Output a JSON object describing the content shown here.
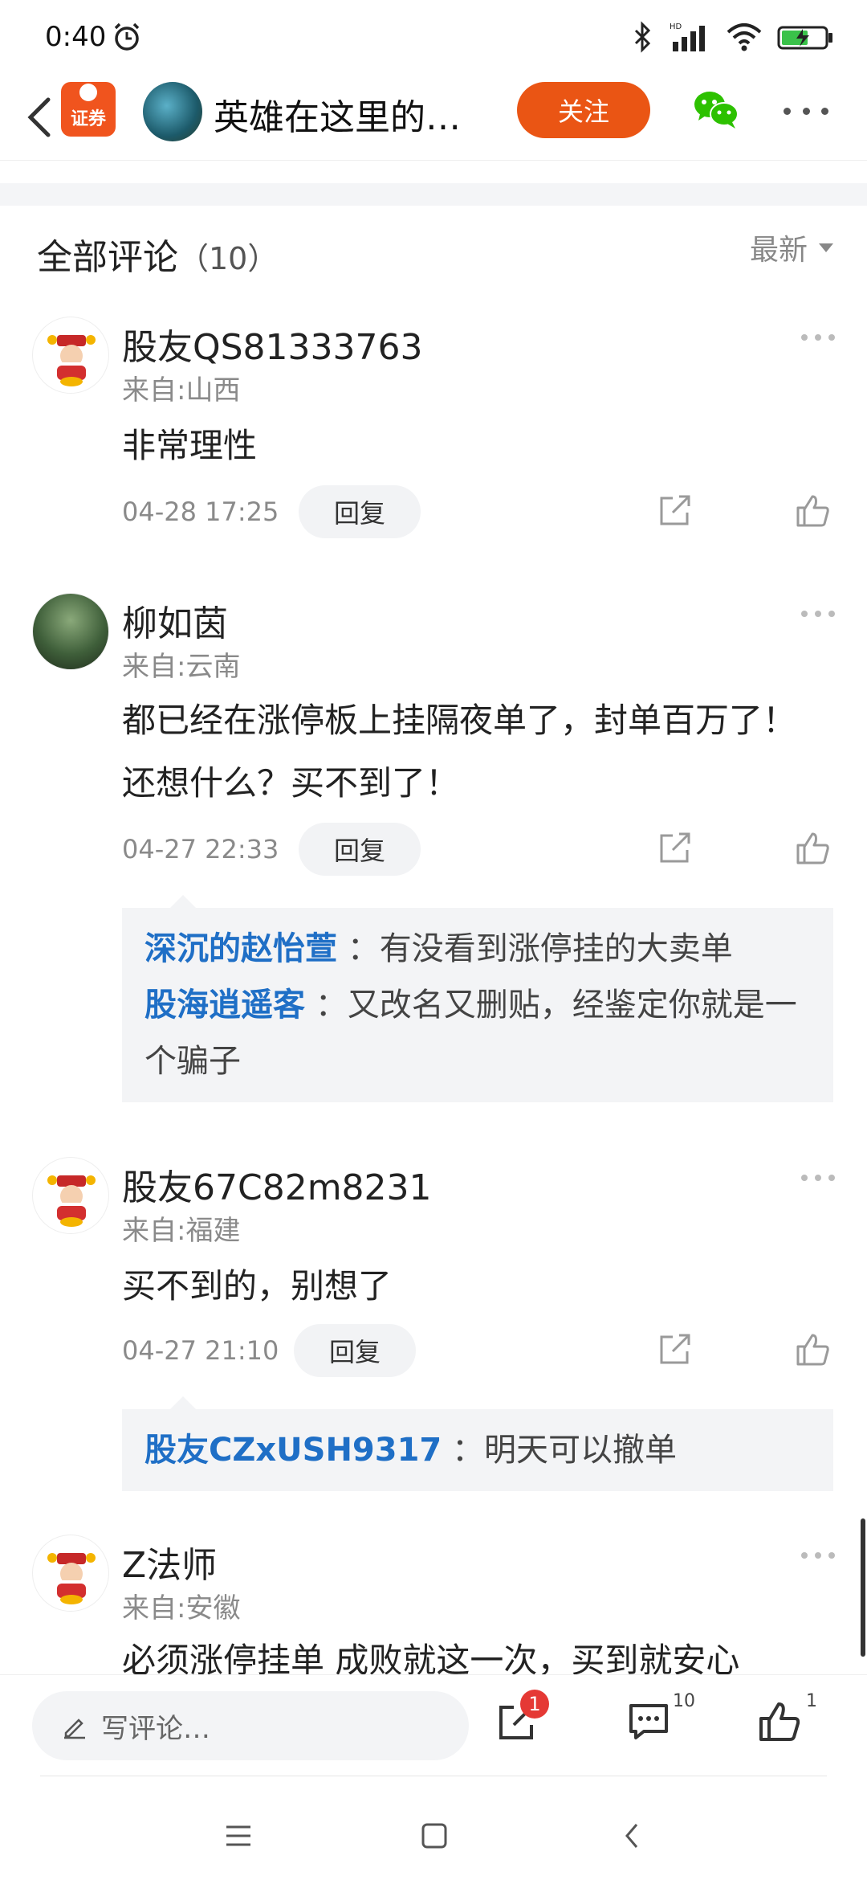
{
  "status_bar": {
    "time": "0:40"
  },
  "header": {
    "app_logo_text": "证券",
    "title": "英雄在这里的…",
    "follow_label": "关注"
  },
  "comments_header": {
    "title": "全部评论",
    "count": "（10）",
    "sort_label": "最新"
  },
  "comments": [
    {
      "name": "股友QS81333763",
      "location": "来自:山西",
      "text": "非常理性",
      "date": "04-28 17:25",
      "reply_label": "回复"
    },
    {
      "name": "柳如茵",
      "location": "来自:云南",
      "text": "都已经在涨停板上挂隔夜单了，封单百万了！还想什么？买不到了！",
      "date": "04-27 22:33",
      "reply_label": "回复",
      "replies": [
        {
          "user": "深沉的赵怡萱",
          "text": "：有没看到涨停挂的大卖单"
        },
        {
          "user": "股海逍遥客",
          "text": "：又改名又删贴，经鉴定你就是一个骗子"
        }
      ]
    },
    {
      "name": "股友67C82m8231",
      "location": "来自:福建",
      "text": "买不到的，别想了",
      "date": "04-27 21:10",
      "reply_label": "回复",
      "replies": [
        {
          "user": "股友CZxUSH9317",
          "text": "：明天可以撤单"
        }
      ]
    },
    {
      "name": "Z法师",
      "location": "来自:安徽",
      "text": "必须涨停挂单 成败就这一次，买到就安心"
    }
  ],
  "bottom_bar": {
    "input_placeholder": "写评论…",
    "share_badge": "1",
    "comment_count": "10",
    "like_count": "1"
  },
  "colors": {
    "accent": "#ea5514",
    "link": "#1f6fc6",
    "badge": "#e53935"
  },
  "icons": [
    "back-icon",
    "alarm-icon",
    "bluetooth-icon",
    "signal-icon",
    "wifi-icon",
    "battery-icon",
    "wechat-icon",
    "more-icon",
    "share-icon",
    "like-icon",
    "edit-icon",
    "comment-icon",
    "menu-icon",
    "home-icon",
    "nav-back-icon"
  ]
}
